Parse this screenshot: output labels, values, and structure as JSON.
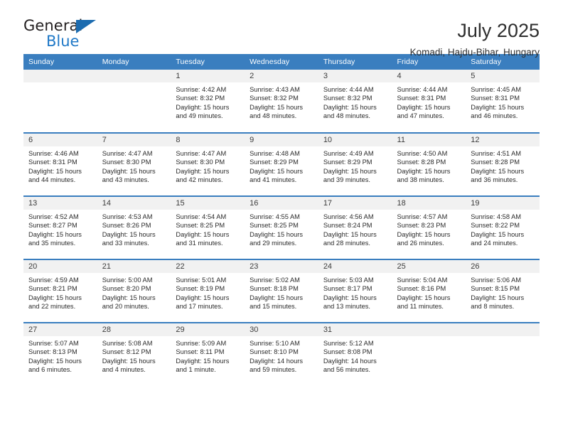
{
  "brand": {
    "name_top": "General",
    "name_bottom": "Blue",
    "triangle_color": "#1c6cb0",
    "blue_color": "#2079c7"
  },
  "header": {
    "title": "July 2025",
    "subtitle": "Komadi, Hajdu-Bihar, Hungary"
  },
  "theme": {
    "header_bg": "#3a7ebf",
    "daynum_bg": "#f1f1f1",
    "page_bg": "#ffffff"
  },
  "calendar": {
    "weekday_headers": [
      "Sunday",
      "Monday",
      "Tuesday",
      "Wednesday",
      "Thursday",
      "Friday",
      "Saturday"
    ],
    "labels": {
      "sunrise": "Sunrise:",
      "sunset": "Sunset:",
      "daylight": "Daylight:"
    },
    "weeks": [
      [
        {
          "day": "",
          "empty": true
        },
        {
          "day": "",
          "empty": true
        },
        {
          "day": "1",
          "sunrise": "Sunrise: 4:42 AM",
          "sunset": "Sunset: 8:32 PM",
          "daylight": "Daylight: 15 hours and 49 minutes."
        },
        {
          "day": "2",
          "sunrise": "Sunrise: 4:43 AM",
          "sunset": "Sunset: 8:32 PM",
          "daylight": "Daylight: 15 hours and 48 minutes."
        },
        {
          "day": "3",
          "sunrise": "Sunrise: 4:44 AM",
          "sunset": "Sunset: 8:32 PM",
          "daylight": "Daylight: 15 hours and 48 minutes."
        },
        {
          "day": "4",
          "sunrise": "Sunrise: 4:44 AM",
          "sunset": "Sunset: 8:31 PM",
          "daylight": "Daylight: 15 hours and 47 minutes."
        },
        {
          "day": "5",
          "sunrise": "Sunrise: 4:45 AM",
          "sunset": "Sunset: 8:31 PM",
          "daylight": "Daylight: 15 hours and 46 minutes."
        }
      ],
      [
        {
          "day": "6",
          "sunrise": "Sunrise: 4:46 AM",
          "sunset": "Sunset: 8:31 PM",
          "daylight": "Daylight: 15 hours and 44 minutes."
        },
        {
          "day": "7",
          "sunrise": "Sunrise: 4:47 AM",
          "sunset": "Sunset: 8:30 PM",
          "daylight": "Daylight: 15 hours and 43 minutes."
        },
        {
          "day": "8",
          "sunrise": "Sunrise: 4:47 AM",
          "sunset": "Sunset: 8:30 PM",
          "daylight": "Daylight: 15 hours and 42 minutes."
        },
        {
          "day": "9",
          "sunrise": "Sunrise: 4:48 AM",
          "sunset": "Sunset: 8:29 PM",
          "daylight": "Daylight: 15 hours and 41 minutes."
        },
        {
          "day": "10",
          "sunrise": "Sunrise: 4:49 AM",
          "sunset": "Sunset: 8:29 PM",
          "daylight": "Daylight: 15 hours and 39 minutes."
        },
        {
          "day": "11",
          "sunrise": "Sunrise: 4:50 AM",
          "sunset": "Sunset: 8:28 PM",
          "daylight": "Daylight: 15 hours and 38 minutes."
        },
        {
          "day": "12",
          "sunrise": "Sunrise: 4:51 AM",
          "sunset": "Sunset: 8:28 PM",
          "daylight": "Daylight: 15 hours and 36 minutes."
        }
      ],
      [
        {
          "day": "13",
          "sunrise": "Sunrise: 4:52 AM",
          "sunset": "Sunset: 8:27 PM",
          "daylight": "Daylight: 15 hours and 35 minutes."
        },
        {
          "day": "14",
          "sunrise": "Sunrise: 4:53 AM",
          "sunset": "Sunset: 8:26 PM",
          "daylight": "Daylight: 15 hours and 33 minutes."
        },
        {
          "day": "15",
          "sunrise": "Sunrise: 4:54 AM",
          "sunset": "Sunset: 8:25 PM",
          "daylight": "Daylight: 15 hours and 31 minutes."
        },
        {
          "day": "16",
          "sunrise": "Sunrise: 4:55 AM",
          "sunset": "Sunset: 8:25 PM",
          "daylight": "Daylight: 15 hours and 29 minutes."
        },
        {
          "day": "17",
          "sunrise": "Sunrise: 4:56 AM",
          "sunset": "Sunset: 8:24 PM",
          "daylight": "Daylight: 15 hours and 28 minutes."
        },
        {
          "day": "18",
          "sunrise": "Sunrise: 4:57 AM",
          "sunset": "Sunset: 8:23 PM",
          "daylight": "Daylight: 15 hours and 26 minutes."
        },
        {
          "day": "19",
          "sunrise": "Sunrise: 4:58 AM",
          "sunset": "Sunset: 8:22 PM",
          "daylight": "Daylight: 15 hours and 24 minutes."
        }
      ],
      [
        {
          "day": "20",
          "sunrise": "Sunrise: 4:59 AM",
          "sunset": "Sunset: 8:21 PM",
          "daylight": "Daylight: 15 hours and 22 minutes."
        },
        {
          "day": "21",
          "sunrise": "Sunrise: 5:00 AM",
          "sunset": "Sunset: 8:20 PM",
          "daylight": "Daylight: 15 hours and 20 minutes."
        },
        {
          "day": "22",
          "sunrise": "Sunrise: 5:01 AM",
          "sunset": "Sunset: 8:19 PM",
          "daylight": "Daylight: 15 hours and 17 minutes."
        },
        {
          "day": "23",
          "sunrise": "Sunrise: 5:02 AM",
          "sunset": "Sunset: 8:18 PM",
          "daylight": "Daylight: 15 hours and 15 minutes."
        },
        {
          "day": "24",
          "sunrise": "Sunrise: 5:03 AM",
          "sunset": "Sunset: 8:17 PM",
          "daylight": "Daylight: 15 hours and 13 minutes."
        },
        {
          "day": "25",
          "sunrise": "Sunrise: 5:04 AM",
          "sunset": "Sunset: 8:16 PM",
          "daylight": "Daylight: 15 hours and 11 minutes."
        },
        {
          "day": "26",
          "sunrise": "Sunrise: 5:06 AM",
          "sunset": "Sunset: 8:15 PM",
          "daylight": "Daylight: 15 hours and 8 minutes."
        }
      ],
      [
        {
          "day": "27",
          "sunrise": "Sunrise: 5:07 AM",
          "sunset": "Sunset: 8:13 PM",
          "daylight": "Daylight: 15 hours and 6 minutes."
        },
        {
          "day": "28",
          "sunrise": "Sunrise: 5:08 AM",
          "sunset": "Sunset: 8:12 PM",
          "daylight": "Daylight: 15 hours and 4 minutes."
        },
        {
          "day": "29",
          "sunrise": "Sunrise: 5:09 AM",
          "sunset": "Sunset: 8:11 PM",
          "daylight": "Daylight: 15 hours and 1 minute."
        },
        {
          "day": "30",
          "sunrise": "Sunrise: 5:10 AM",
          "sunset": "Sunset: 8:10 PM",
          "daylight": "Daylight: 14 hours and 59 minutes."
        },
        {
          "day": "31",
          "sunrise": "Sunrise: 5:12 AM",
          "sunset": "Sunset: 8:08 PM",
          "daylight": "Daylight: 14 hours and 56 minutes."
        },
        {
          "day": "",
          "empty": true
        },
        {
          "day": "",
          "empty": true
        }
      ]
    ]
  }
}
